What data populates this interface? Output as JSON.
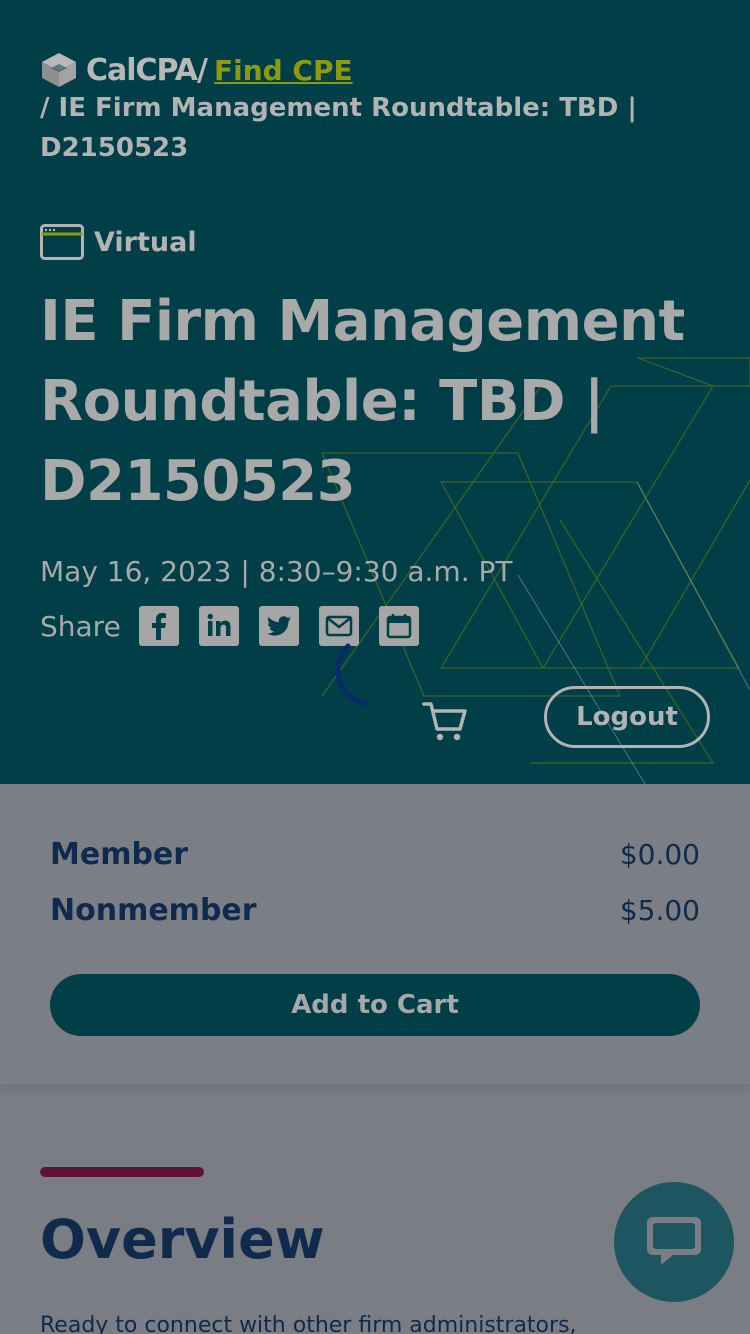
{
  "header": {
    "brand_name": "CalCPA",
    "brand_separator": "/",
    "find_cpe_link": "Find CPE",
    "breadcrumb_current": "/ IE Firm Management Roundtable: TBD | D2150523"
  },
  "event": {
    "format_label": "Virtual",
    "format_icon": "browser-window-icon",
    "title": "IE Firm Management Roundtable: TBD | D2150523",
    "date_time": "May 16, 2023 | 8:30–9:30 a.m. PT"
  },
  "share": {
    "label": "Share",
    "icons": [
      "facebook-icon",
      "linkedin-icon",
      "twitter-icon",
      "email-icon",
      "calendar-icon"
    ]
  },
  "actions": {
    "cart_icon": "cart-icon",
    "logout_label": "Logout"
  },
  "pricing": {
    "rows": [
      {
        "label": "Member",
        "value": "$0.00"
      },
      {
        "label": "Nonmember",
        "value": "$5.00"
      }
    ],
    "add_to_cart_label": "Add to Cart"
  },
  "overview": {
    "title": "Overview",
    "intro": "Ready to connect with other firm administrators,"
  },
  "chat": {
    "icon": "chat-bubble-icon"
  },
  "colors": {
    "hero_bg": "#003e48",
    "accent_link": "#8e9a0e",
    "overview_accent": "#5f1236",
    "text_dark": "#0f2a4c"
  }
}
